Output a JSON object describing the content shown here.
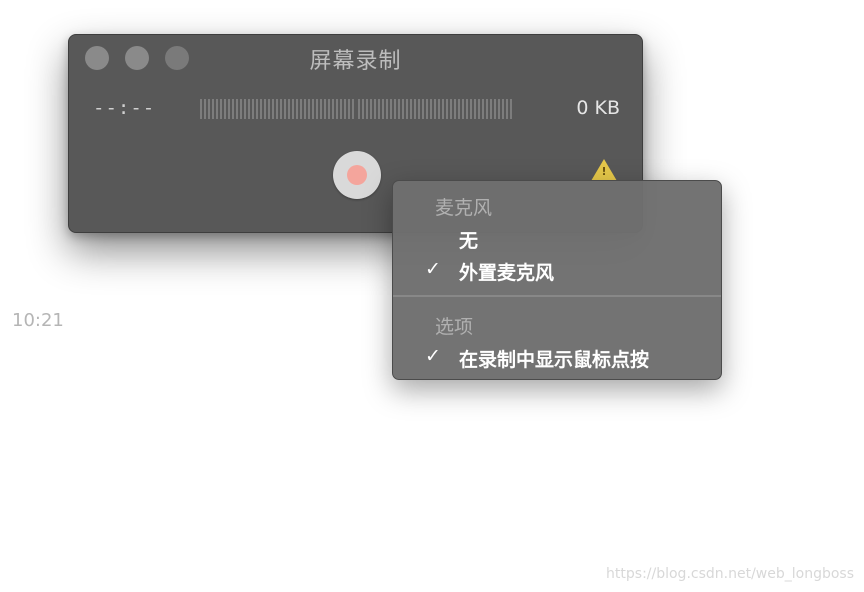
{
  "window": {
    "title": "屏幕录制",
    "time": "--:--",
    "file_size": "0 KB"
  },
  "timestamp": "10:21",
  "menu": {
    "microphone_header": "麦克风",
    "mic_items": [
      {
        "label": "无",
        "check": ""
      },
      {
        "label": "外置麦克风",
        "check": "✓"
      }
    ],
    "options_header": "选项",
    "option_items": [
      {
        "label": "在录制中显示鼠标点按",
        "check": "✓"
      }
    ]
  },
  "watermark": "https://blog.csdn.net/web_longboss",
  "colors": {
    "window_bg": "#585858",
    "record_dot": "#f4a59c",
    "warning": "#e6c84a"
  },
  "icons": {
    "close": "traffic-light-close",
    "minimize": "traffic-light-minimize",
    "zoom": "traffic-light-zoom",
    "record": "record-icon",
    "warning": "warning-icon",
    "check": "checkmark-icon"
  }
}
